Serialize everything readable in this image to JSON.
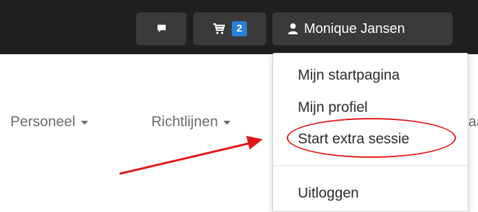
{
  "topbar": {
    "messages_icon": "chat-bubble-icon",
    "cart_icon": "cart-icon",
    "cart_count": "2",
    "user_icon": "user-icon",
    "user_name": "Monique Jansen"
  },
  "nav": {
    "items": [
      {
        "label": "Personeel"
      },
      {
        "label": "Richtlijnen"
      },
      {
        "label": "aa"
      }
    ]
  },
  "user_menu": {
    "items": [
      {
        "label": "Mijn startpagina"
      },
      {
        "label": "Mijn profiel"
      },
      {
        "label": "Start extra sessie"
      },
      {
        "label": "Uitloggen"
      }
    ],
    "highlighted_item": "Start extra sessie"
  },
  "colors": {
    "topbar_bg": "#1f1f1f",
    "button_bg": "#3a3a3a",
    "badge_bg": "#2c7fd6",
    "annotation_red": "#e01818"
  }
}
